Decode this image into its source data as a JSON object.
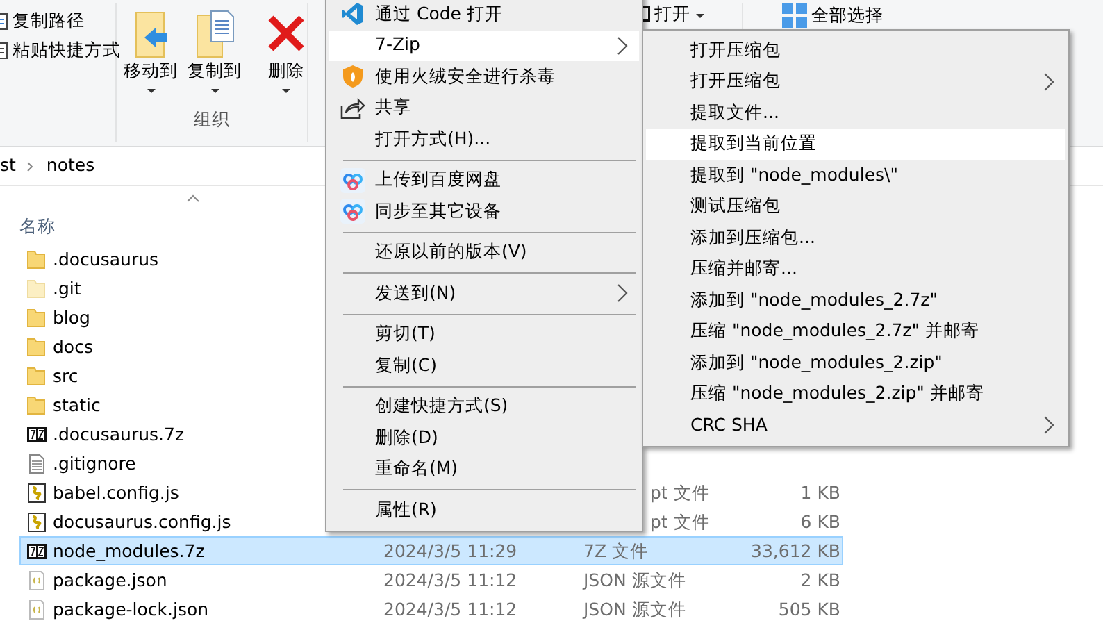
{
  "ribbon": {
    "clipboard": [
      "复制路径",
      "粘贴快捷方式"
    ],
    "organize": {
      "buttons": [
        "移动到",
        "复制到",
        "删除"
      ],
      "group_label": "组织"
    },
    "open_button": "打开",
    "select_all": "全部选择"
  },
  "breadcrumb": [
    "st",
    "notes"
  ],
  "column_header": "名称",
  "files": [
    {
      "name": ".docusaurus",
      "kind": "folder",
      "selected": false
    },
    {
      "name": ".git",
      "kind": "hiddenfolder",
      "selected": false
    },
    {
      "name": "blog",
      "kind": "folder",
      "selected": false
    },
    {
      "name": "docs",
      "kind": "folder",
      "selected": false
    },
    {
      "name": "src",
      "kind": "folder",
      "selected": false
    },
    {
      "name": "static",
      "kind": "folder",
      "selected": false
    },
    {
      "name": ".docusaurus.7z",
      "kind": "archive",
      "selected": false
    },
    {
      "name": ".gitignore",
      "kind": "text",
      "selected": false
    },
    {
      "name": "babel.config.js",
      "kind": "script",
      "selected": false,
      "type": "pt 文件",
      "type_clipped": true,
      "size": "1 KB"
    },
    {
      "name": "docusaurus.config.js",
      "kind": "script",
      "selected": false,
      "type": "pt 文件",
      "type_clipped": true,
      "size": "6 KB"
    },
    {
      "name": "node_modules.7z",
      "kind": "archive",
      "selected": true,
      "date": "2024/3/5 11:29",
      "type": "7Z 文件",
      "size": "33,612 KB"
    },
    {
      "name": "package.json",
      "kind": "json",
      "selected": false,
      "date": "2024/3/5 11:12",
      "type": "JSON 源文件",
      "size": "2 KB"
    },
    {
      "name": "package-lock.json",
      "kind": "json",
      "selected": false,
      "date": "2024/3/5 11:12",
      "type": "JSON 源文件",
      "size": "505 KB"
    }
  ],
  "context_menu": {
    "items": [
      {
        "kind": "code",
        "label": "通过 Code 打开",
        "submenu": false,
        "selected": false
      },
      {
        "kind": "text",
        "label": "7-Zip",
        "submenu": true,
        "selected": true
      },
      {
        "kind": "shield",
        "label": "使用火绒安全进行杀毒",
        "submenu": false,
        "selected": false
      },
      {
        "kind": "share",
        "label": "共享",
        "submenu": false,
        "selected": false
      },
      {
        "kind": "text",
        "label": "打开方式(H)...",
        "submenu": false,
        "selected": false
      },
      {
        "kind": "separator"
      },
      {
        "kind": "cloud",
        "label": "上传到百度网盘",
        "submenu": false,
        "selected": false
      },
      {
        "kind": "cloud",
        "label": "同步至其它设备",
        "submenu": false,
        "selected": false
      },
      {
        "kind": "separator"
      },
      {
        "kind": "text",
        "label": "还原以前的版本(V)",
        "submenu": false,
        "selected": false
      },
      {
        "kind": "separator"
      },
      {
        "kind": "text",
        "label": "发送到(N)",
        "submenu": true,
        "selected": false
      },
      {
        "kind": "separator"
      },
      {
        "kind": "text",
        "label": "剪切(T)",
        "submenu": false,
        "selected": false
      },
      {
        "kind": "text",
        "label": "复制(C)",
        "submenu": false,
        "selected": false
      },
      {
        "kind": "separator"
      },
      {
        "kind": "text",
        "label": "创建快捷方式(S)",
        "submenu": false,
        "selected": false
      },
      {
        "kind": "text",
        "label": "删除(D)",
        "submenu": false,
        "selected": false
      },
      {
        "kind": "text",
        "label": "重命名(M)",
        "submenu": false,
        "selected": false
      },
      {
        "kind": "separator"
      },
      {
        "kind": "text",
        "label": "属性(R)",
        "submenu": false,
        "selected": false
      }
    ]
  },
  "zip_submenu": {
    "items": [
      {
        "label": "打开压缩包",
        "submenu": false,
        "selected": false
      },
      {
        "label": "打开压缩包",
        "submenu": true,
        "selected": false
      },
      {
        "label": "提取文件...",
        "submenu": false,
        "selected": false
      },
      {
        "label": "提取到当前位置",
        "submenu": false,
        "selected": true
      },
      {
        "label": "提取到 \"node_modules\\\"",
        "submenu": false,
        "selected": false
      },
      {
        "label": "测试压缩包",
        "submenu": false,
        "selected": false
      },
      {
        "label": "添加到压缩包...",
        "submenu": false,
        "selected": false
      },
      {
        "label": "压缩并邮寄...",
        "submenu": false,
        "selected": false
      },
      {
        "label": "添加到 \"node_modules_2.7z\"",
        "submenu": false,
        "selected": false
      },
      {
        "label": "压缩 \"node_modules_2.7z\" 并邮寄",
        "submenu": false,
        "selected": false
      },
      {
        "label": "添加到 \"node_modules_2.zip\"",
        "submenu": false,
        "selected": false
      },
      {
        "label": "压缩 \"node_modules_2.zip\" 并邮寄",
        "submenu": false,
        "selected": false
      },
      {
        "label": "CRC SHA",
        "submenu": true,
        "selected": false
      }
    ]
  }
}
